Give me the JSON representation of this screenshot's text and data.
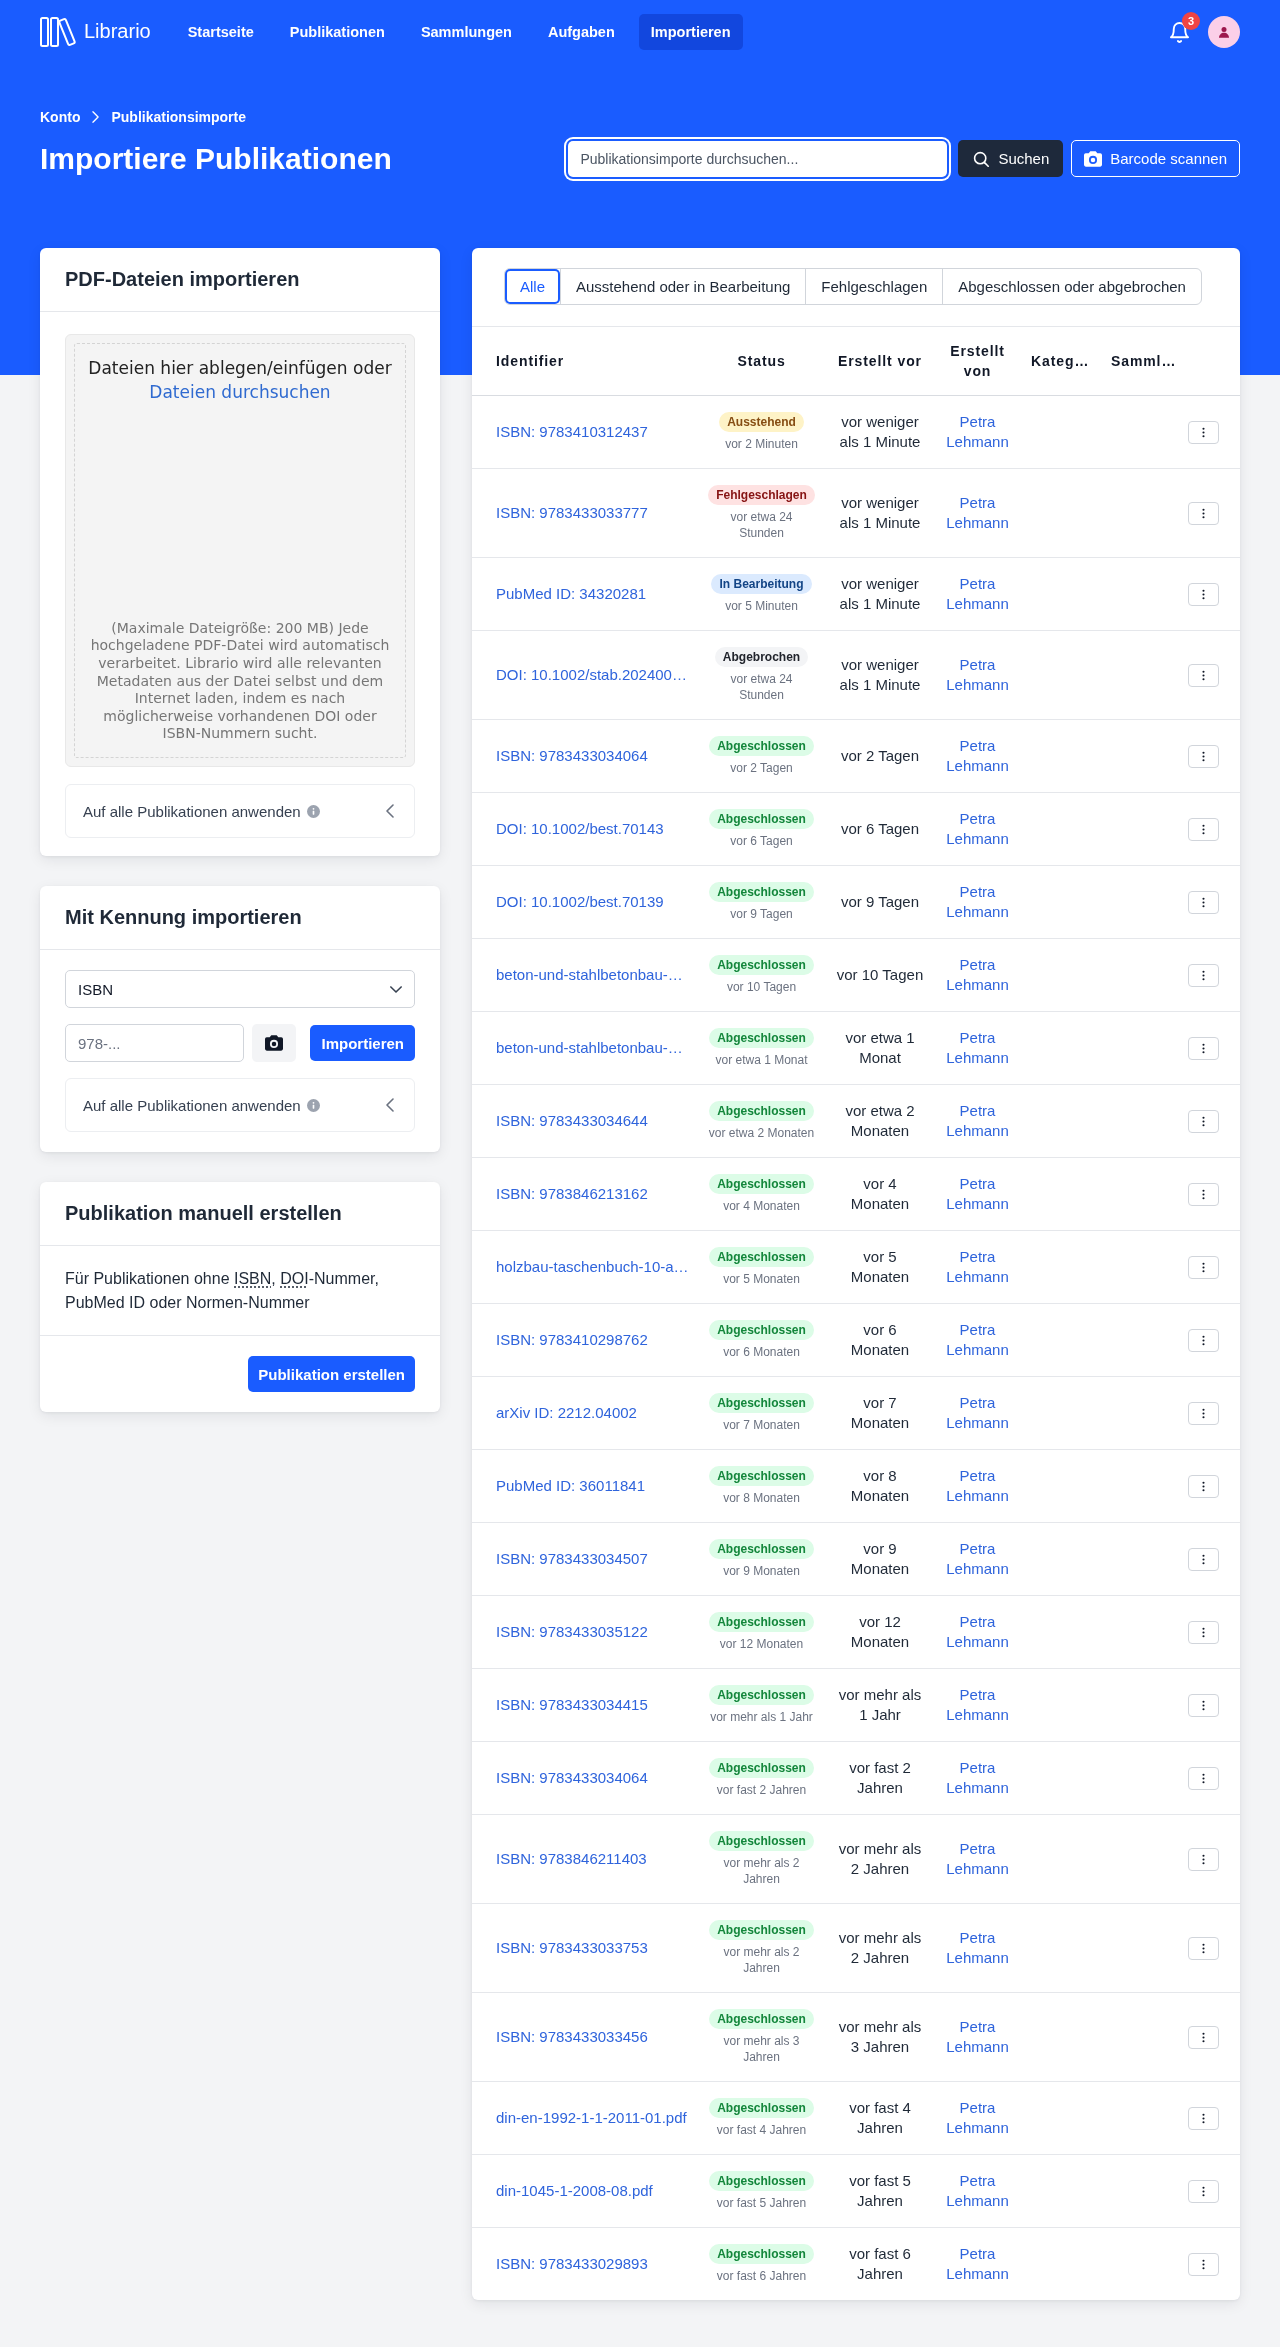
{
  "nav": {
    "logo": "Librario",
    "items": [
      {
        "label": "Startseite",
        "selected": false
      },
      {
        "label": "Publikationen",
        "selected": false
      },
      {
        "label": "Sammlungen",
        "selected": false
      },
      {
        "label": "Aufgaben",
        "selected": false
      },
      {
        "label": "Importieren",
        "selected": true
      }
    ],
    "notifications": "3"
  },
  "breadcrumb": [
    "Konto",
    "Publikationsimporte"
  ],
  "title": "Importiere Publikationen",
  "search": {
    "placeholder": "Publikationsimporte durchsuchen...",
    "button": "Suchen",
    "barcode_button": "Barcode scannen"
  },
  "pdf_import": {
    "title": "PDF-Dateien importieren",
    "drop_text": "Dateien hier ablegen/einfügen oder",
    "browse_link": "Dateien durchsuchen",
    "hint": "(Maximale Dateigröße: 200 MB) Jede hochgeladene PDF-Datei wird automatisch verarbeitet. Librario wird alle relevanten Metadaten aus der Datei selbst und dem Internet laden, indem es nach möglicherweise vorhandenen DOI oder ISBN-Nummern sucht.",
    "apply_all": {
      "label": "Auf alle Publikationen anwenden",
      "expanded": false
    }
  },
  "identifier_import": {
    "title": "Mit Kennung importieren",
    "type_select": {
      "value": "ISBN"
    },
    "input": {
      "placeholder": "978-..."
    },
    "import_button": "Importieren",
    "apply_all": {
      "label": "Auf alle Publikationen anwenden",
      "expanded": false
    }
  },
  "manual_create": {
    "title": "Publikation manuell erstellen",
    "description": [
      {
        "text": "Für Publikationen ohne ",
        "abbr": false
      },
      {
        "text": "ISBN",
        "abbr": true
      },
      {
        "text": ", ",
        "abbr": false
      },
      {
        "text": "DOI",
        "abbr": true
      },
      {
        "text": "-Nummer, PubMed ID oder Normen-Nummer",
        "abbr": false
      }
    ],
    "button": "Publikation erstellen"
  },
  "imports": {
    "tabs": [
      {
        "label": "Alle",
        "selected": true
      },
      {
        "label": "Ausstehend oder in Bearbeitung",
        "selected": false
      },
      {
        "label": "Fehlgeschlagen",
        "selected": false
      },
      {
        "label": "Abgeschlossen oder abgebrochen",
        "selected": false
      }
    ],
    "columns": [
      "Identifier",
      "Status",
      "Erstellt vor",
      "Erstellt von",
      "Kateg…",
      "Samml…"
    ],
    "rows": [
      {
        "identifier": "ISBN: 9783410312437",
        "status": "Ausstehend",
        "color": "#fef3c7",
        "status_time": "vor 2 Minuten",
        "created_ago": "vor weniger als 1 Minute",
        "created_by": "Petra Lehmann"
      },
      {
        "identifier": "ISBN: 9783433033777",
        "status": "Fehlgeschlagen",
        "color": "#fee2e2",
        "status_time": "vor etwa 24 Stunden",
        "created_ago": "vor weniger als 1 Minute",
        "created_by": "Petra Lehmann"
      },
      {
        "identifier": "PubMed ID: 34320281",
        "status": "In Bearbeitung",
        "color": "#dbeafe",
        "status_time": "vor 5 Minuten",
        "created_ago": "vor weniger als 1 Minute",
        "created_by": "Petra Lehmann"
      },
      {
        "identifier": "DOI: 10.1002/stab.202400…",
        "status": "Abgebrochen",
        "color": "#f3f4f6",
        "status_time": "vor etwa 24 Stunden",
        "created_ago": "vor weniger als 1 Minute",
        "created_by": "Petra Lehmann"
      },
      {
        "identifier": "ISBN: 9783433034064",
        "status": "Abgeschlossen",
        "color": "#dcfce7",
        "status_time": "vor 2 Tagen",
        "created_ago": "vor 2 Tagen",
        "created_by": "Petra Lehmann"
      },
      {
        "identifier": "DOI: 10.1002/best.70143",
        "status": "Abgeschlossen",
        "color": "#dcfce7",
        "status_time": "vor 6 Tagen",
        "created_ago": "vor 6 Tagen",
        "created_by": "Petra Lehmann"
      },
      {
        "identifier": "DOI: 10.1002/best.70139",
        "status": "Abgeschlossen",
        "color": "#dcfce7",
        "status_time": "vor 9 Tagen",
        "created_ago": "vor 9 Tagen",
        "created_by": "Petra Lehmann"
      },
      {
        "identifier": "beton-und-stahlbetonbau-…",
        "status": "Abgeschlossen",
        "color": "#dcfce7",
        "status_time": "vor 10 Tagen",
        "created_ago": "vor 10 Tagen",
        "created_by": "Petra Lehmann"
      },
      {
        "identifier": "beton-und-stahlbetonbau-…",
        "status": "Abgeschlossen",
        "color": "#dcfce7",
        "status_time": "vor etwa 1 Monat",
        "created_ago": "vor etwa 1 Monat",
        "created_by": "Petra Lehmann"
      },
      {
        "identifier": "ISBN: 9783433034644",
        "status": "Abgeschlossen",
        "color": "#dcfce7",
        "status_time": "vor etwa 2 Monaten",
        "created_ago": "vor etwa 2 Monaten",
        "created_by": "Petra Lehmann"
      },
      {
        "identifier": "ISBN: 9783846213162",
        "status": "Abgeschlossen",
        "color": "#dcfce7",
        "status_time": "vor 4 Monaten",
        "created_ago": "vor 4 Monaten",
        "created_by": "Petra Lehmann"
      },
      {
        "identifier": "holzbau-taschenbuch-10-a…",
        "status": "Abgeschlossen",
        "color": "#dcfce7",
        "status_time": "vor 5 Monaten",
        "created_ago": "vor 5 Monaten",
        "created_by": "Petra Lehmann"
      },
      {
        "identifier": "ISBN: 9783410298762",
        "status": "Abgeschlossen",
        "color": "#dcfce7",
        "status_time": "vor 6 Monaten",
        "created_ago": "vor 6 Monaten",
        "created_by": "Petra Lehmann"
      },
      {
        "identifier": "arXiv ID: 2212.04002",
        "status": "Abgeschlossen",
        "color": "#dcfce7",
        "status_time": "vor 7 Monaten",
        "created_ago": "vor 7 Monaten",
        "created_by": "Petra Lehmann"
      },
      {
        "identifier": "PubMed ID: 36011841",
        "status": "Abgeschlossen",
        "color": "#dcfce7",
        "status_time": "vor 8 Monaten",
        "created_ago": "vor 8 Monaten",
        "created_by": "Petra Lehmann"
      },
      {
        "identifier": "ISBN: 9783433034507",
        "status": "Abgeschlossen",
        "color": "#dcfce7",
        "status_time": "vor 9 Monaten",
        "created_ago": "vor 9 Monaten",
        "created_by": "Petra Lehmann"
      },
      {
        "identifier": "ISBN: 9783433035122",
        "status": "Abgeschlossen",
        "color": "#dcfce7",
        "status_time": "vor 12 Monaten",
        "created_ago": "vor 12 Monaten",
        "created_by": "Petra Lehmann"
      },
      {
        "identifier": "ISBN: 9783433034415",
        "status": "Abgeschlossen",
        "color": "#dcfce7",
        "status_time": "vor mehr als 1 Jahr",
        "created_ago": "vor mehr als 1 Jahr",
        "created_by": "Petra Lehmann"
      },
      {
        "identifier": "ISBN: 9783433034064",
        "status": "Abgeschlossen",
        "color": "#dcfce7",
        "status_time": "vor fast 2 Jahren",
        "created_ago": "vor fast 2 Jahren",
        "created_by": "Petra Lehmann"
      },
      {
        "identifier": "ISBN: 9783846211403",
        "status": "Abgeschlossen",
        "color": "#dcfce7",
        "status_time": "vor mehr als 2 Jahren",
        "created_ago": "vor mehr als 2 Jahren",
        "created_by": "Petra Lehmann"
      },
      {
        "identifier": "ISBN: 9783433033753",
        "status": "Abgeschlossen",
        "color": "#dcfce7",
        "status_time": "vor mehr als 2 Jahren",
        "created_ago": "vor mehr als 2 Jahren",
        "created_by": "Petra Lehmann"
      },
      {
        "identifier": "ISBN: 9783433033456",
        "status": "Abgeschlossen",
        "color": "#dcfce7",
        "status_time": "vor mehr als 3 Jahren",
        "created_ago": "vor mehr als 3 Jahren",
        "created_by": "Petra Lehmann"
      },
      {
        "identifier": "din-en-1992-1-1-2011-01.pdf",
        "status": "Abgeschlossen",
        "color": "#dcfce7",
        "status_time": "vor fast 4 Jahren",
        "created_ago": "vor fast 4 Jahren",
        "created_by": "Petra Lehmann"
      },
      {
        "identifier": "din-1045-1-2008-08.pdf",
        "status": "Abgeschlossen",
        "color": "#dcfce7",
        "status_time": "vor fast 5 Jahren",
        "created_ago": "vor fast 5 Jahren",
        "created_by": "Petra Lehmann"
      },
      {
        "identifier": "ISBN: 9783433029893",
        "status": "Abgeschlossen",
        "color": "#dcfce7",
        "status_time": "vor fast 6 Jahren",
        "created_ago": "vor fast 6 Jahren",
        "created_by": "Petra Lehmann"
      }
    ]
  }
}
